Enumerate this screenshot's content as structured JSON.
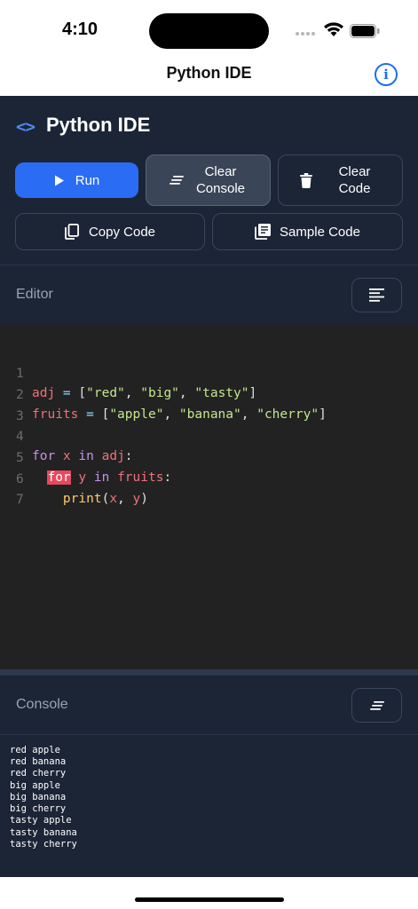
{
  "status_bar": {
    "time": "4:10"
  },
  "nav": {
    "title": "Python IDE",
    "info_icon": "info-circle-icon"
  },
  "header": {
    "brand_icon": "code-brackets-icon",
    "brand_glyph": "<>",
    "title": "Python IDE",
    "accent_color": "#2b6cf4"
  },
  "toolbar": {
    "run_label": "Run",
    "clear_console_line1": "Clear",
    "clear_console_line2": "Console",
    "clear_code_line1": "Clear",
    "clear_code_line2": "Code",
    "copy_label": "Copy Code",
    "sample_label": "Sample Code"
  },
  "editor": {
    "label": "Editor",
    "line_numbers": [
      "1",
      "2",
      "3",
      "4",
      "5",
      "6",
      "7"
    ],
    "tokens": {
      "l1": [
        "adj",
        " = ",
        "[",
        "\"red\"",
        ", ",
        "\"big\"",
        ", ",
        "\"tasty\"",
        "]"
      ],
      "l2": [
        "fruits",
        " = ",
        "[",
        "\"apple\"",
        ", ",
        "\"banana\"",
        ", ",
        "\"cherry\"",
        "]"
      ],
      "l4": [
        "for",
        " x ",
        "in",
        " adj",
        ":"
      ],
      "l5": [
        "  ",
        "for",
        " y ",
        "in",
        " fruits",
        ":"
      ],
      "l6": [
        "    ",
        "print",
        "(",
        "x",
        ", ",
        "y",
        ")"
      ]
    }
  },
  "console": {
    "label": "Console",
    "lines": [
      "red apple",
      "red banana",
      "red cherry",
      "big apple",
      "big banana",
      "big cherry",
      "tasty apple",
      "tasty banana",
      "tasty cherry"
    ]
  }
}
